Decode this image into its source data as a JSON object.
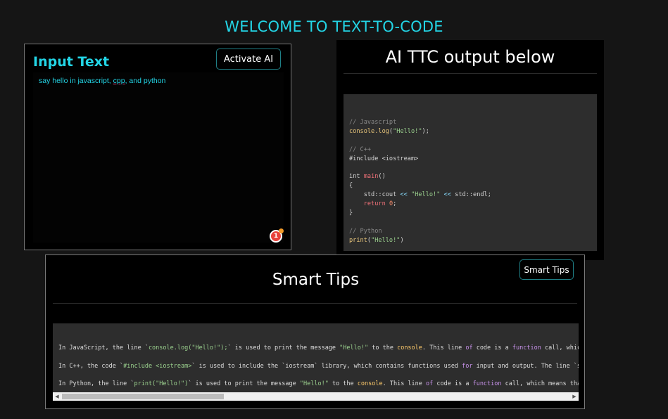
{
  "page_title": "WELCOME TO TEXT-TO-CODE",
  "input_panel": {
    "heading": "Input Text",
    "activate_label": "Activate AI",
    "text_before": "say hello in javascript, ",
    "text_misspelled": "cpp",
    "text_after": ", and python",
    "grammarly_count": "1"
  },
  "output_panel": {
    "heading": "AI TTC output below",
    "code": {
      "js_comment": "// Javascript",
      "js_fn": "console.log",
      "js_str": "\"Hello!\"",
      "cpp_comment": "// C++",
      "cpp_include": "#include <iostream>",
      "cpp_int": "int",
      "cpp_main": "main",
      "cpp_cout": "std::cout",
      "cpp_op": "<<",
      "cpp_str": "\"Hello!\"",
      "cpp_endl": "std::endl",
      "cpp_return": "return",
      "cpp_zero": "0",
      "py_comment": "// Python",
      "py_fn": "print",
      "py_str": "\"Hello!\""
    }
  },
  "tips_panel": {
    "heading": "Smart Tips",
    "button_label": "Smart Tips",
    "tip1": {
      "a": "In JavaScript, the line `",
      "b": "console.log(\"Hello!\");",
      "c": "` is used to print the message ",
      "d": "\"Hello!\"",
      "e": " to the ",
      "f": "console",
      "g": ". This line ",
      "h": "of",
      "i": " code is a ",
      "j": "function",
      "k": " call, which means that"
    },
    "tip2": {
      "a": "In C++, the code `",
      "b": "#include <iostream>",
      "c": "` is used to include the `iostream` library, which contains functions used ",
      "d": "for",
      "e": " input and output. The line `std::cout <<"
    },
    "tip3": {
      "a": "In Python, the line `",
      "b": "print(\"Hello!\")",
      "c": "` is used to print the message ",
      "d": "\"Hello!\"",
      "e": " to the ",
      "f": "console",
      "g": ". This line ",
      "h": "of",
      "i": " code is a ",
      "j": "function",
      "k": " call, which means that it calls a"
    }
  },
  "icons": {
    "grammarly": "grammarly-icon",
    "scroll_left": "scroll-left-arrow-icon",
    "scroll_right": "scroll-right-arrow-icon"
  },
  "colors": {
    "accent": "#23d5e6",
    "background": "#151515",
    "panel": "#000000",
    "code_bg": "#2d2d2d"
  }
}
